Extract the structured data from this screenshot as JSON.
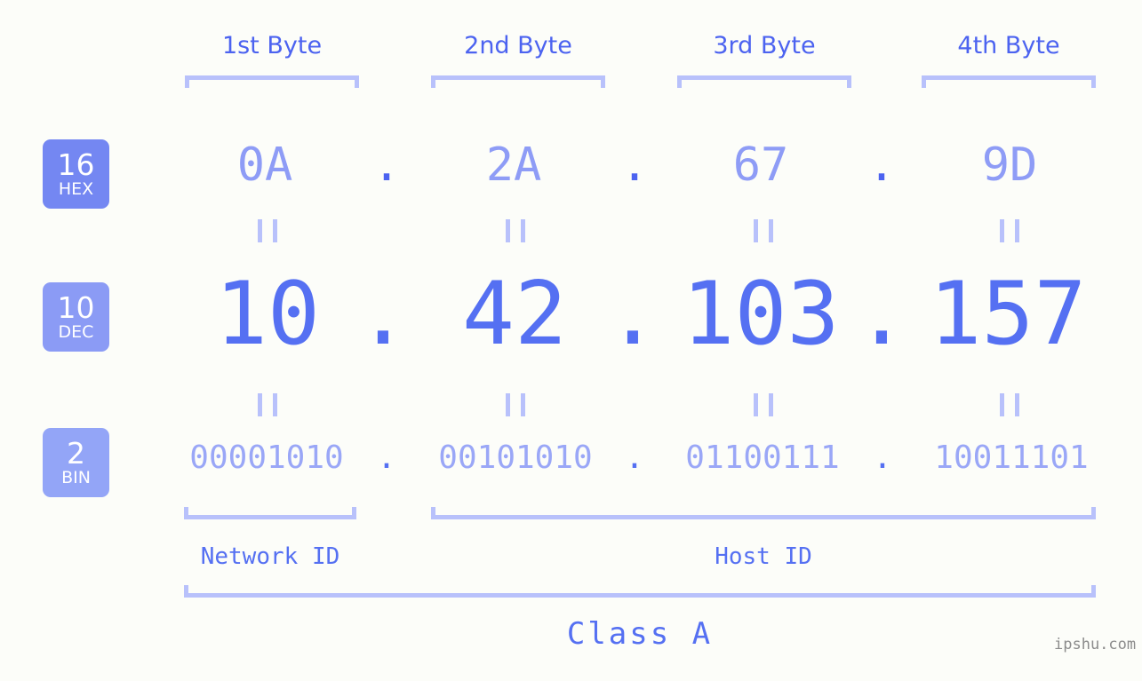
{
  "background_color": "#fcfdf9",
  "accent_color": "#5570f2",
  "bracket_color": "#b8c1fb",
  "byte_headers": [
    {
      "label": "1st Byte"
    },
    {
      "label": "2nd Byte"
    },
    {
      "label": "3rd Byte"
    },
    {
      "label": "4th Byte"
    }
  ],
  "bases": [
    {
      "number": "16",
      "name": "HEX",
      "color": "#7487f2"
    },
    {
      "number": "10",
      "name": "DEC",
      "color": "#8b9bf5"
    },
    {
      "number": "2",
      "name": "BIN",
      "color": "#93a5f7"
    }
  ],
  "rows": {
    "hex": {
      "values": [
        "0A",
        "2A",
        "67",
        "9D"
      ],
      "separator": "."
    },
    "dec": {
      "values": [
        "10",
        "42",
        "103",
        "157"
      ],
      "separator": "."
    },
    "bin": {
      "values": [
        "00001010",
        "00101010",
        "01100111",
        "10011101"
      ],
      "separator": "."
    }
  },
  "equals_marks": {
    "glyph": "=",
    "count_per_row": 4
  },
  "segments": [
    {
      "name": "Network ID"
    },
    {
      "name": "Host ID"
    }
  ],
  "class": {
    "label": "Class A"
  },
  "watermark": {
    "text": "ipshu.com"
  }
}
